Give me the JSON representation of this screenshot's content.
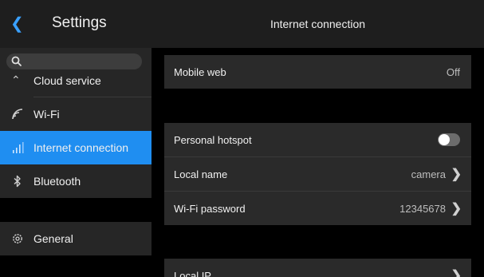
{
  "sidebar": {
    "title": "Settings",
    "back_icon": "chevron-left-icon",
    "accent_color": "#1f8ef1",
    "search": {
      "value": "",
      "placeholder": ""
    },
    "items": [
      {
        "label": "Cloud service",
        "icon": "cloud-icon"
      },
      {
        "label": "Wi-Fi",
        "icon": "wifi-icon"
      },
      {
        "label": "Internet connection",
        "icon": "signal-icon",
        "active": true
      },
      {
        "label": "Bluetooth",
        "icon": "bluetooth-icon"
      },
      {
        "label": "General",
        "icon": "gear-icon"
      }
    ]
  },
  "main": {
    "title": "Internet connection",
    "mobile_web": {
      "label": "Mobile web",
      "value": "Off"
    },
    "personal_hotspot": {
      "label": "Personal hotspot",
      "enabled": false
    },
    "local_name": {
      "label": "Local name",
      "value": "camera"
    },
    "wifi_password": {
      "label": "Wi-Fi password",
      "value": "12345678"
    },
    "local_ip": {
      "label": "Local IP"
    }
  }
}
